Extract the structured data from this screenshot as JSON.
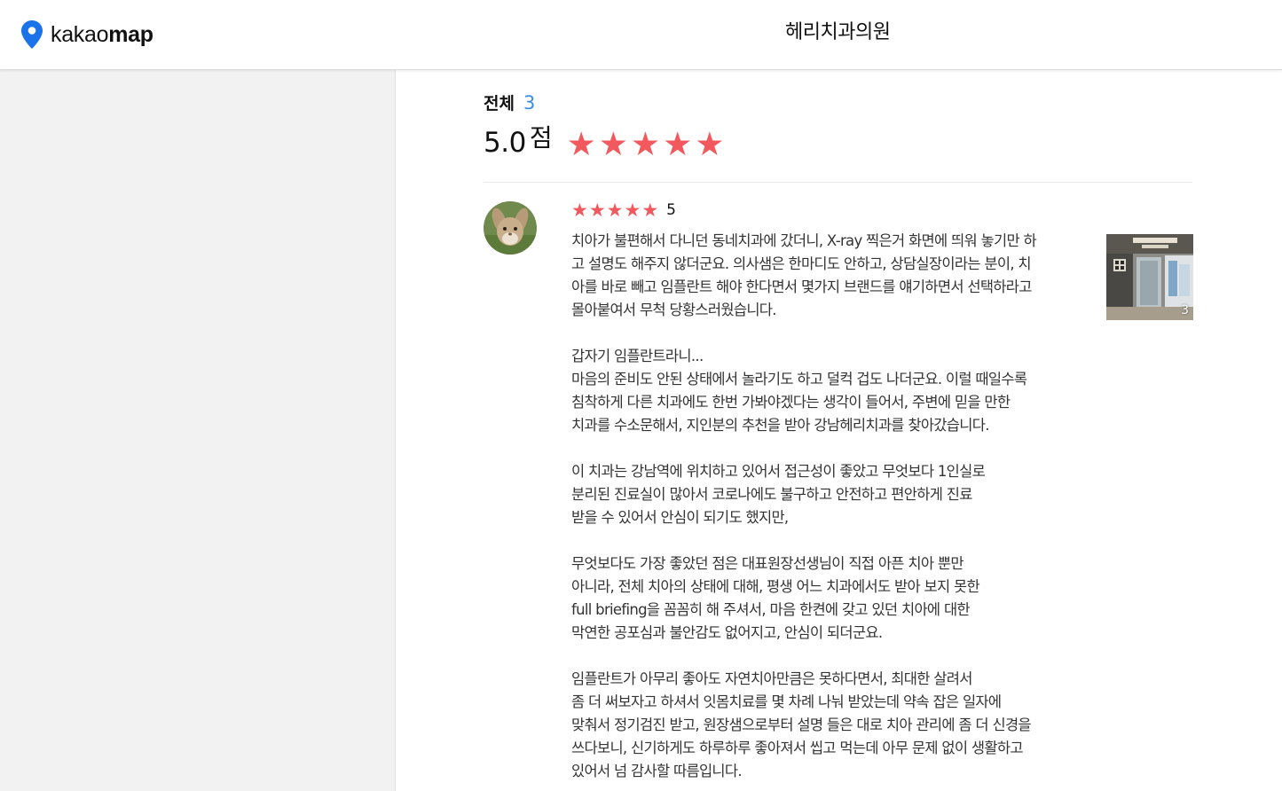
{
  "app": {
    "logo_light": "kakao",
    "logo_bold": "map",
    "pin_color": "#1a73e8"
  },
  "header": {
    "place_name": "헤리치과의원"
  },
  "summary": {
    "total_label": "전체",
    "total_count": "3",
    "score": "5.0",
    "score_unit": "점",
    "rating_out_of": 5,
    "rating_value": 5
  },
  "review": {
    "star_count": 5,
    "rating": "5",
    "photo_count": "3",
    "lines": [
      "치아가 불편해서 다니던 동네치과에 갔더니, X-ray 찍은거 화면에 띄워 놓기만 하",
      "고  설명도 해주지 않더군요.  의사샘은 한마디도 안하고, 상담실장이라는 분이, 치",
      "아를 바로 빼고 임플란트 해야 한다면서 몇가지 브랜드를 얘기하면서 선택하라고",
      "몰아붙여서 무척 당황스러웠습니다.",
      "",
      "갑자기 임플란트라니...",
      "마음의 준비도 안된 상태에서 놀라기도 하고  덜컥 겁도 나더군요.  이럴 때일수록",
      "침착하게 다른 치과에도 한번 가봐야겠다는 생각이 들어서, 주변에 믿을 만한",
      "치과를 수소문해서, 지인분의 추천을 받아 강남헤리치과를 찾아갔습니다.",
      "",
      "이 치과는 강남역에 위치하고 있어서 접근성이 좋았고 무엇보다 1인실로",
      "분리된 진료실이 많아서 코로나에도 불구하고 안전하고 편안하게 진료",
      "받을 수 있어서 안심이 되기도 했지만,",
      "",
      "무엇보다도 가장 좋았던 점은 대표원장선생님이 직접 아픈 치아 뿐만",
      "아니라, 전체 치아의 상태에 대해, 평생 어느 치과에서도 받아 보지 못한",
      "full briefing을 꼼꼼히 해 주셔서, 마음 한켠에 갖고 있던 치아에 대한",
      "막연한 공포심과 불안감도 없어지고, 안심이 되더군요.",
      "",
      "임플란트가 아무리 좋아도 자연치아만큼은 못하다면서, 최대한 살려서",
      "좀 더 써보자고 하셔서 잇몸치료를 몇 차례 나눠 받았는데 약속 잡은 일자에",
      "맞춰서 정기검진 받고, 원장샘으로부터 설명 들은 대로  치아 관리에 좀 더 신경을",
      "쓰다보니, 신기하게도 하루하루 좋아져서 씹고 먹는데 아무 문제 없이 생활하고",
      "있어서 넘 감사할 따름입니다."
    ]
  },
  "colors": {
    "star": "#f2595e",
    "count_accent": "#3a8ee6"
  },
  "icons": {
    "logo_pin": "map-pin-icon",
    "star": "star-icon"
  }
}
